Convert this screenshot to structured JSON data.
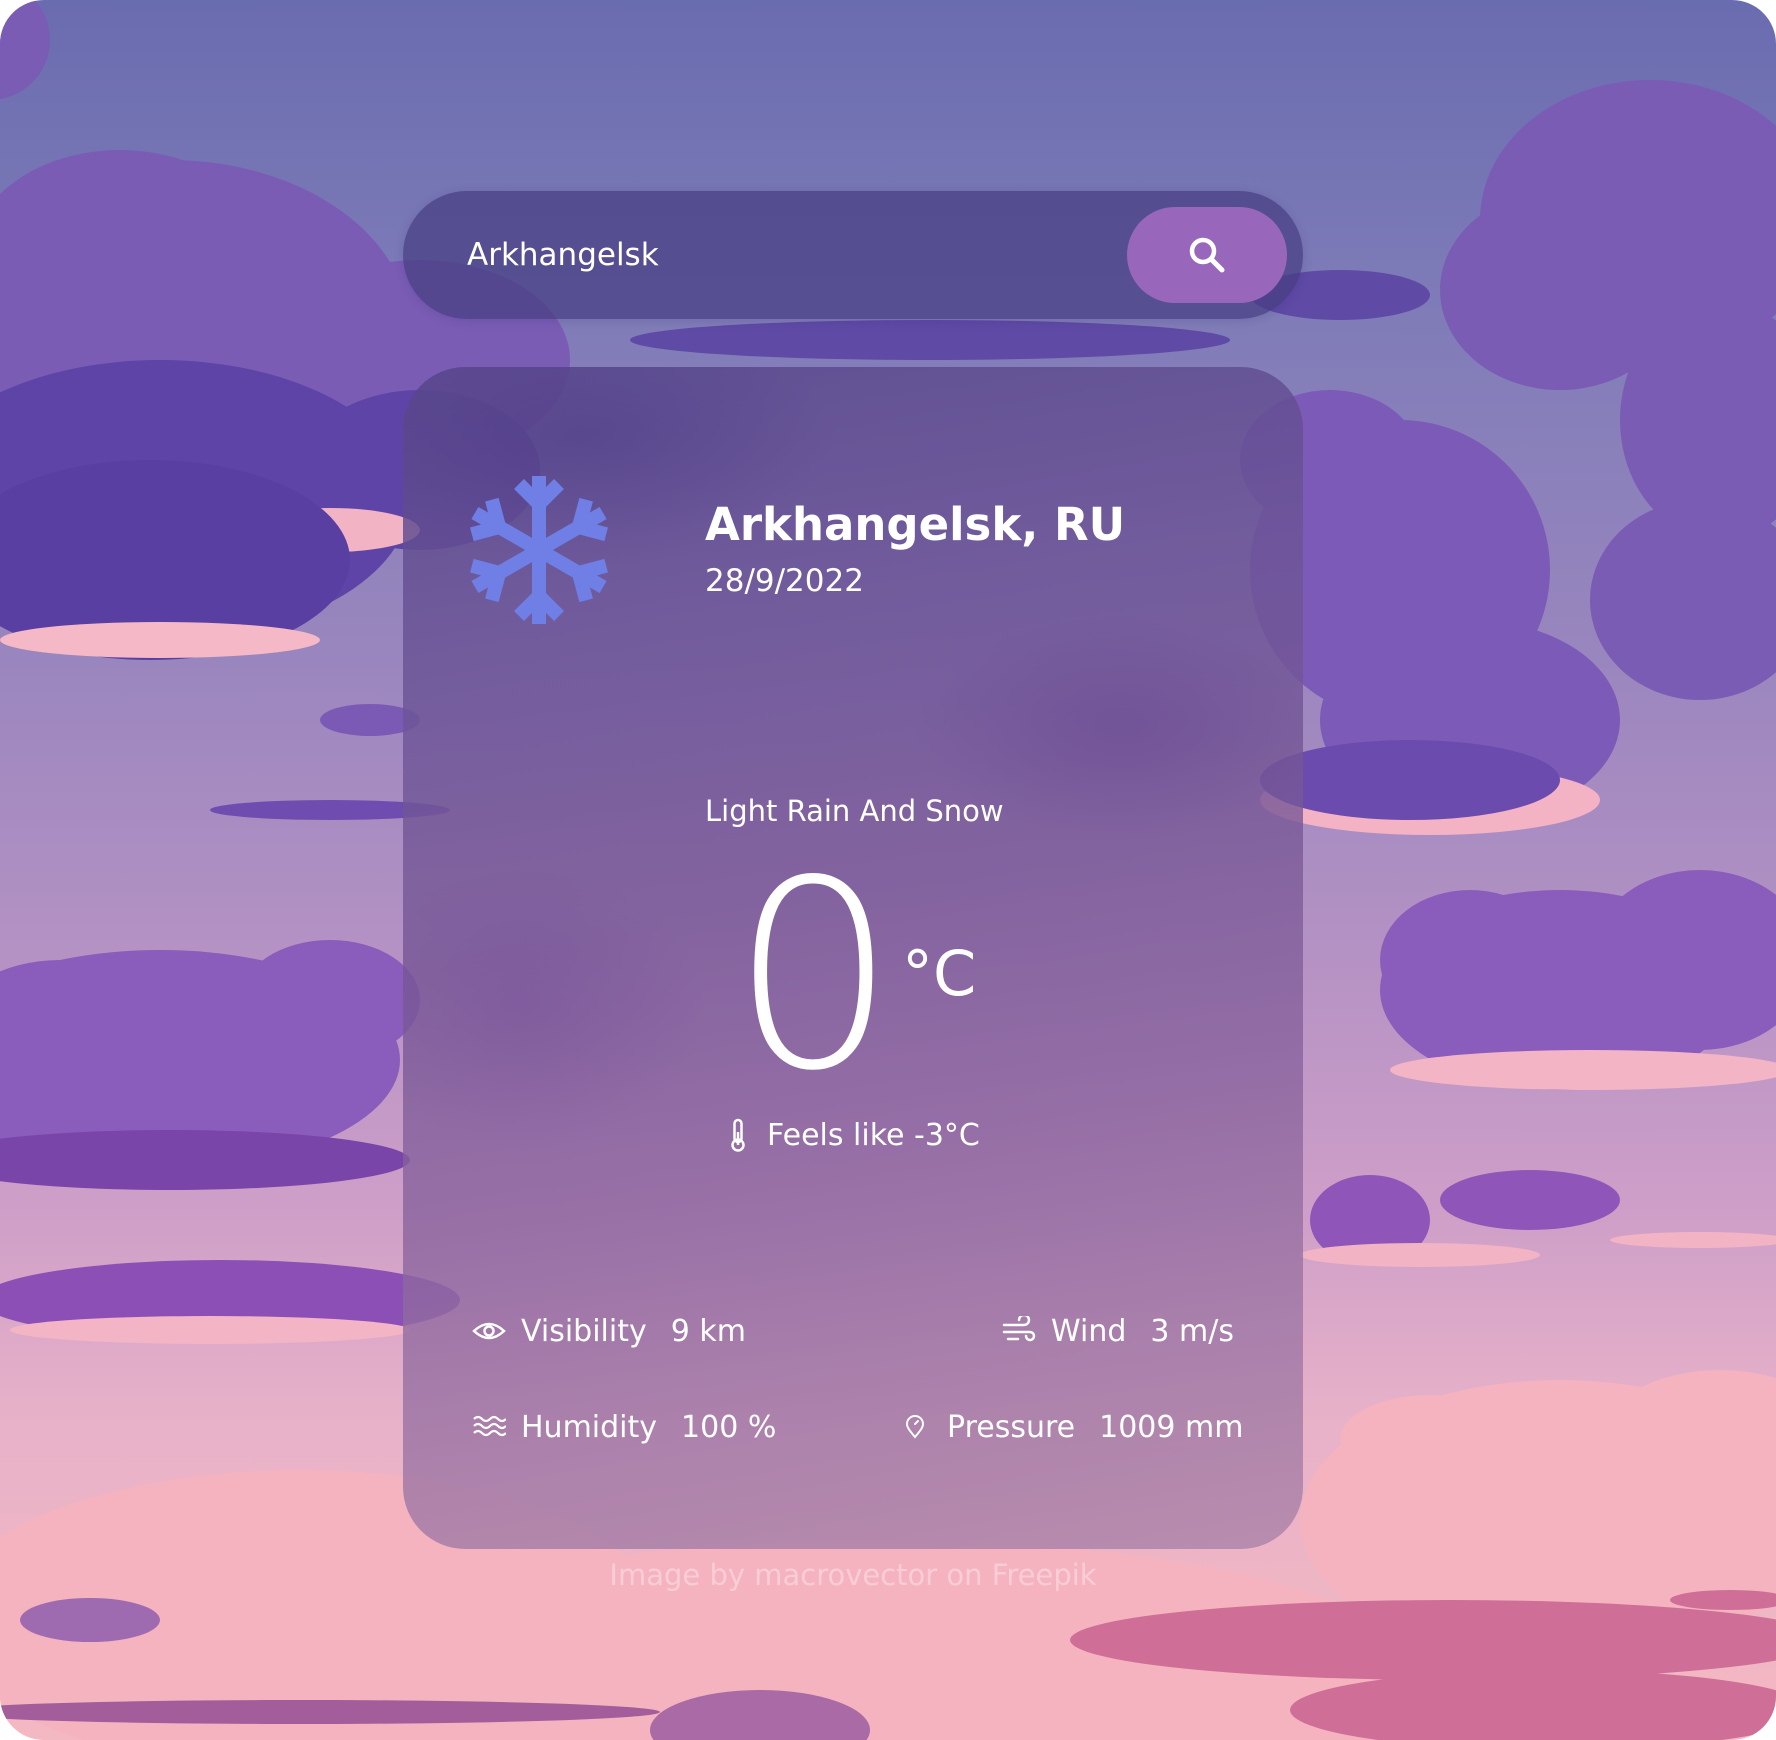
{
  "search": {
    "value": "Arkhangelsk",
    "button_icon": "search-icon"
  },
  "weather": {
    "icon": "snowflake-icon",
    "city": "Arkhangelsk, RU",
    "date": "28/9/2022",
    "condition": "Light Rain And Snow",
    "temperature": "0",
    "unit": "°C",
    "feels_like": "Feels like -3°C",
    "feels_icon": "thermometer-icon"
  },
  "stats": [
    {
      "icon": "eye-icon",
      "label": "Visibility",
      "value": "9 km"
    },
    {
      "icon": "wind-icon",
      "label": "Wind",
      "value": "3 m/s"
    },
    {
      "icon": "humidity-icon",
      "label": "Humidity",
      "value": "100 %"
    },
    {
      "icon": "pressure-icon",
      "label": "Pressure",
      "value": "1009 mm"
    }
  ],
  "credit": "Image by macrovector on Freepik",
  "colors": {
    "accent": "#9867bb",
    "snowflake": "#6f7fe6",
    "text": "#ffffff"
  }
}
